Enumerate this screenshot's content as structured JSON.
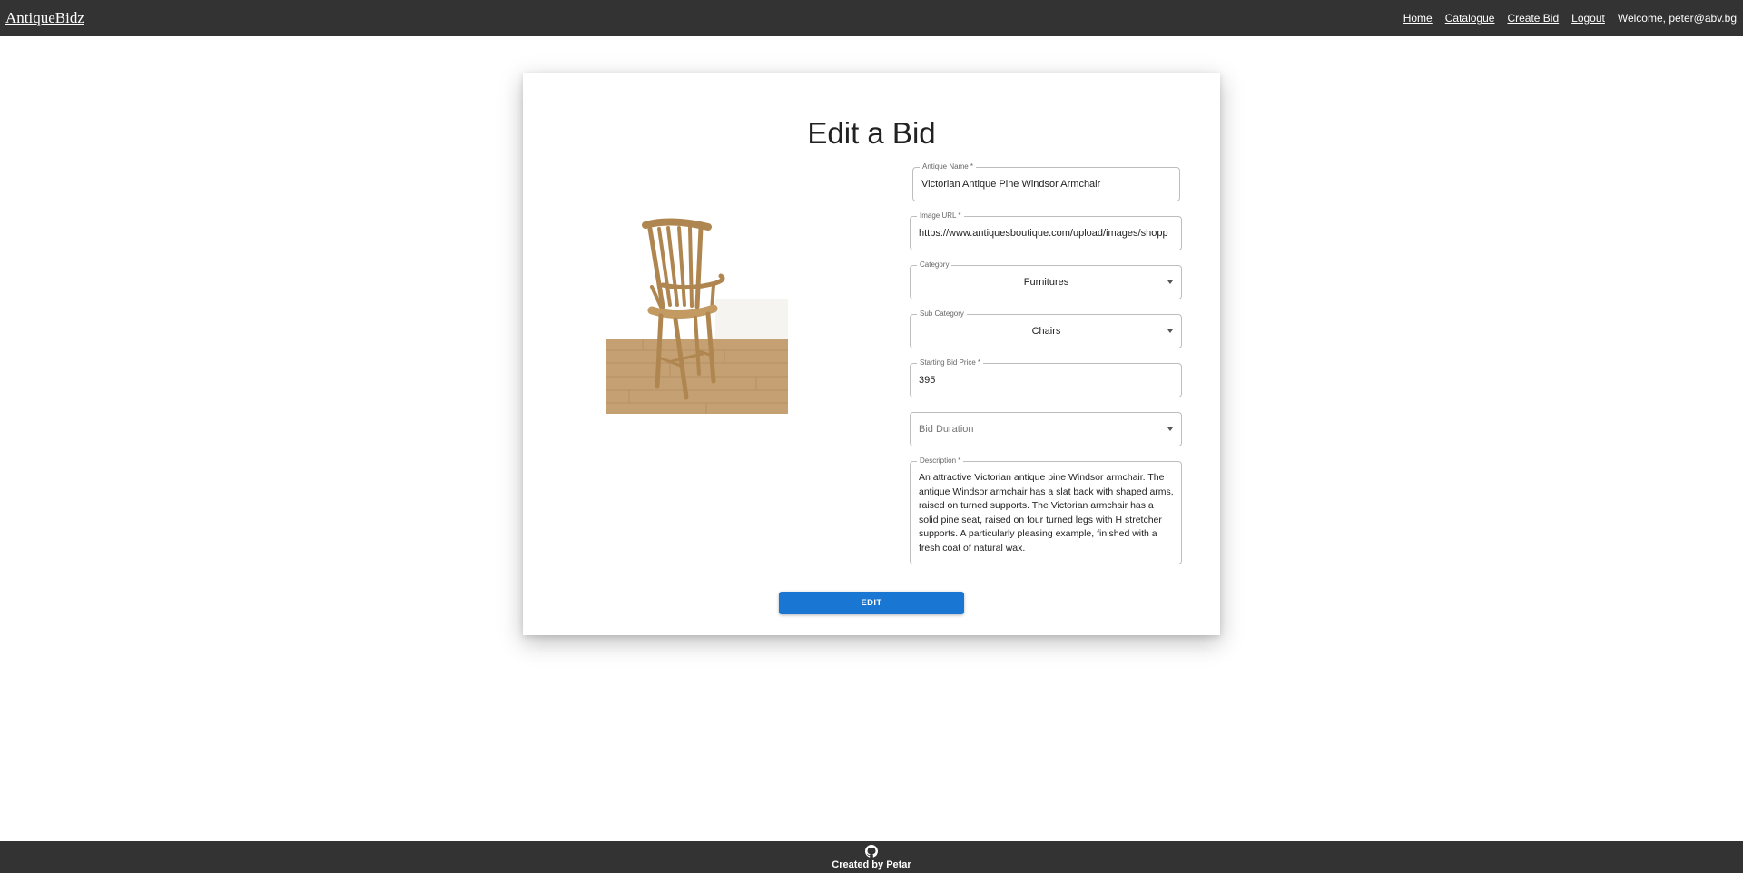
{
  "header": {
    "logo": "AntiqueBidz",
    "nav": {
      "home": "Home",
      "catalogue": "Catalogue",
      "create_bid": "Create Bid",
      "logout": "Logout"
    },
    "welcome": "Welcome, peter@abv.bg"
  },
  "form": {
    "title": "Edit a Bid",
    "image_alt": "Victorian Antique Pine Windsor Armchair",
    "antique_name": {
      "label": "Antique Name *",
      "value": "Victorian Antique Pine Windsor Armchair"
    },
    "image_url": {
      "label": "Image URL *",
      "value": "https://www.antiquesboutique.com/upload/images/shopp"
    },
    "category": {
      "label": "Category",
      "value": "Furnitures"
    },
    "sub_category": {
      "label": "Sub Category",
      "value": "Chairs"
    },
    "starting_bid_price": {
      "label": "Starting Bid Price *",
      "value": "395"
    },
    "bid_duration": {
      "placeholder": "Bid Duration"
    },
    "description": {
      "label": "Description *",
      "value": "An attractive Victorian antique pine Windsor armchair. The antique Windsor armchair has a slat back with shaped arms, raised on turned supports. The Victorian armchair has a solid pine seat, raised on four turned legs with H stretcher supports. A particularly pleasing example, finished with a fresh coat of natural wax."
    },
    "submit_label": "EDIT"
  },
  "footer": {
    "icon": "github-icon",
    "credit": "Created by Petar"
  }
}
